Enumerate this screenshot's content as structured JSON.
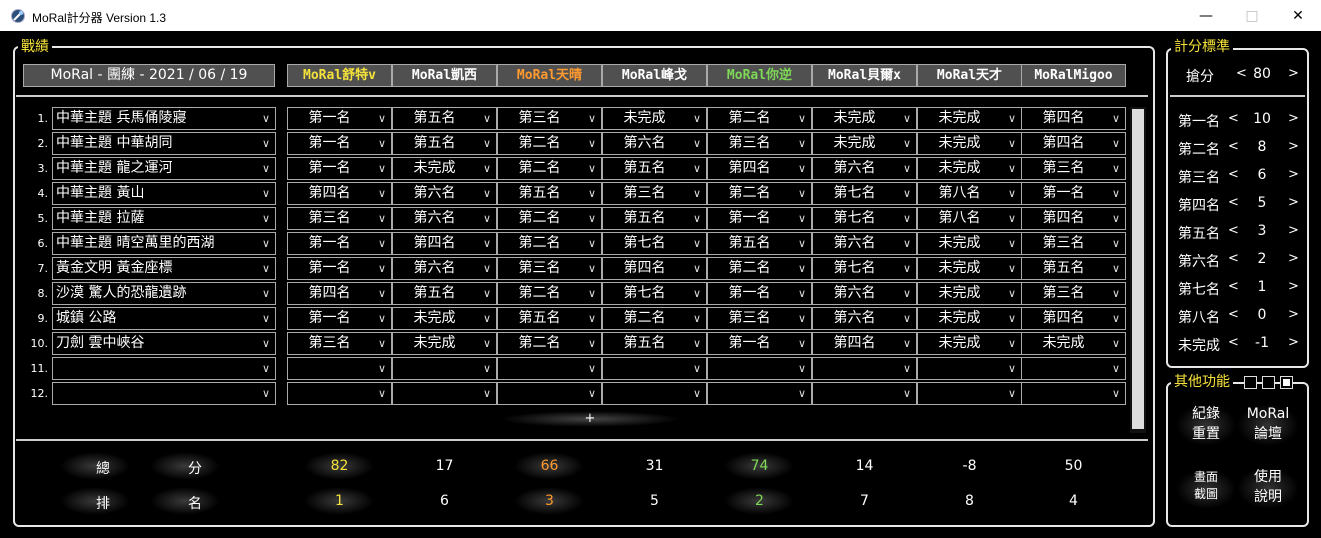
{
  "window": {
    "title": "MoRal計分器 Version 1.3"
  },
  "record": {
    "legend": "戰績",
    "date_header": "MoRal - 團練 - 2021 / 06 / 19",
    "players": [
      {
        "name": "MoRal舒特v",
        "color": "#f5e23a"
      },
      {
        "name": "MoRal凱西",
        "color": "#ffffff"
      },
      {
        "name": "MoRal天晴",
        "color": "#ff9a2e"
      },
      {
        "name": "MoRal峰戈",
        "color": "#ffffff"
      },
      {
        "name": "MoRal你逆",
        "color": "#7ed957"
      },
      {
        "name": "MoRal貝爾x",
        "color": "#ffffff"
      },
      {
        "name": "MoRal天才",
        "color": "#ffffff"
      },
      {
        "name": "MoRalMigoo",
        "color": "#ffffff"
      }
    ],
    "rows": [
      {
        "num": "1.",
        "map": "中華主題 兵馬俑陵寢",
        "ranks": [
          "第一名",
          "第五名",
          "第三名",
          "未完成",
          "第二名",
          "未完成",
          "未完成",
          "第四名"
        ]
      },
      {
        "num": "2.",
        "map": "中華主題 中華胡同",
        "ranks": [
          "第一名",
          "第五名",
          "第二名",
          "第六名",
          "第三名",
          "未完成",
          "未完成",
          "第四名"
        ]
      },
      {
        "num": "3.",
        "map": "中華主題 龍之運河",
        "ranks": [
          "第一名",
          "未完成",
          "第二名",
          "第五名",
          "第四名",
          "第六名",
          "未完成",
          "第三名"
        ]
      },
      {
        "num": "4.",
        "map": "中華主題 黃山",
        "ranks": [
          "第四名",
          "第六名",
          "第五名",
          "第三名",
          "第二名",
          "第七名",
          "第八名",
          "第一名"
        ]
      },
      {
        "num": "5.",
        "map": "中華主題 拉薩",
        "ranks": [
          "第三名",
          "第六名",
          "第二名",
          "第五名",
          "第一名",
          "第七名",
          "第八名",
          "第四名"
        ]
      },
      {
        "num": "6.",
        "map": "中華主題 晴空萬里的西湖",
        "ranks": [
          "第一名",
          "第四名",
          "第二名",
          "第七名",
          "第五名",
          "第六名",
          "未完成",
          "第三名"
        ]
      },
      {
        "num": "7.",
        "map": "黃金文明 黃金座標",
        "ranks": [
          "第一名",
          "第六名",
          "第三名",
          "第四名",
          "第二名",
          "第七名",
          "未完成",
          "第五名"
        ]
      },
      {
        "num": "8.",
        "map": "沙漠 驚人的恐龍遺跡",
        "ranks": [
          "第四名",
          "第五名",
          "第二名",
          "第七名",
          "第一名",
          "第六名",
          "未完成",
          "第三名"
        ]
      },
      {
        "num": "9.",
        "map": "城鎮 公路",
        "ranks": [
          "第一名",
          "未完成",
          "第五名",
          "第二名",
          "第三名",
          "第六名",
          "未完成",
          "第四名"
        ]
      },
      {
        "num": "10.",
        "map": "刀劍 雲中峽谷",
        "ranks": [
          "第三名",
          "未完成",
          "第二名",
          "第五名",
          "第一名",
          "第四名",
          "未完成",
          "未完成"
        ]
      },
      {
        "num": "11.",
        "map": "",
        "ranks": [
          "",
          "",
          "",
          "",
          "",
          "",
          "",
          ""
        ]
      },
      {
        "num": "12.",
        "map": "",
        "ranks": [
          "",
          "",
          "",
          "",
          "",
          "",
          "",
          ""
        ]
      }
    ],
    "add_label": "+",
    "total_label_a": "總",
    "total_label_b": "分",
    "rank_label_a": "排",
    "rank_label_b": "名",
    "totals": [
      "82",
      "17",
      "66",
      "31",
      "74",
      "14",
      "-8",
      "50"
    ],
    "ranking": [
      "1",
      "6",
      "3",
      "5",
      "2",
      "7",
      "8",
      "4"
    ]
  },
  "scoring": {
    "legend": "計分標準",
    "grab": {
      "label": "搶分",
      "value": "80"
    },
    "items": [
      {
        "label": "第一名",
        "value": "10"
      },
      {
        "label": "第二名",
        "value": "8"
      },
      {
        "label": "第三名",
        "value": "6"
      },
      {
        "label": "第四名",
        "value": "5"
      },
      {
        "label": "第五名",
        "value": "3"
      },
      {
        "label": "第六名",
        "value": "2"
      },
      {
        "label": "第七名",
        "value": "1"
      },
      {
        "label": "第八名",
        "value": "0"
      },
      {
        "label": "未完成",
        "value": "-1"
      }
    ],
    "dec": "<",
    "inc": ">"
  },
  "other": {
    "legend": "其他功能",
    "reset": {
      "l1": "紀錄",
      "l2": "重置"
    },
    "forum": {
      "l1": "MoRal",
      "l2": "論壇"
    },
    "capture": {
      "l1": "畫面",
      "l2": "截圖"
    },
    "help": {
      "l1": "使用",
      "l2": "說明"
    }
  }
}
